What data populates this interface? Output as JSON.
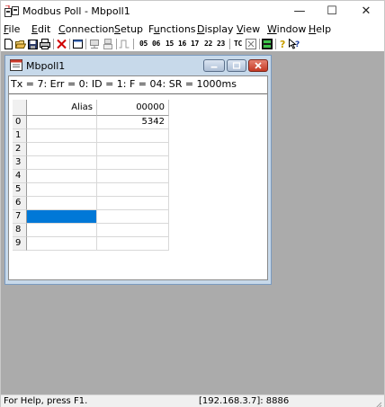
{
  "window": {
    "title": "Modbus Poll - Mbpoll1",
    "controls": {
      "minimize": "—",
      "maximize": "☐",
      "close": "✕"
    }
  },
  "menu": [
    {
      "pre": "",
      "u": "F",
      "post": "ile"
    },
    {
      "pre": "",
      "u": "E",
      "post": "dit"
    },
    {
      "pre": "",
      "u": "C",
      "post": "onnection"
    },
    {
      "pre": "",
      "u": "S",
      "post": "etup"
    },
    {
      "pre": "F",
      "u": "u",
      "post": "nctions"
    },
    {
      "pre": "",
      "u": "D",
      "post": "isplay"
    },
    {
      "pre": "",
      "u": "V",
      "post": "iew"
    },
    {
      "pre": "",
      "u": "W",
      "post": "indow"
    },
    {
      "pre": "",
      "u": "H",
      "post": "elp"
    }
  ],
  "toolbar": {
    "function_codes": [
      "05",
      "06",
      "15",
      "16",
      "17",
      "22",
      "23"
    ],
    "tc_label": "TC",
    "icons": [
      "new-icon",
      "open-icon",
      "save-icon",
      "print-icon",
      "delete-icon",
      "window-icon",
      "connect-icon",
      "disconnect-icon",
      "pulse-icon",
      "communication-icon",
      "monitor-icon",
      "about-icon",
      "context-help-icon"
    ]
  },
  "child": {
    "title": "Mbpoll1",
    "status_line": "Tx = 7: Err = 0: ID = 1: F = 04: SR = 1000ms",
    "grid": {
      "col_alias": "Alias",
      "col_value": "00000",
      "rows": [
        {
          "n": "0",
          "value": "5342"
        },
        {
          "n": "1",
          "value": ""
        },
        {
          "n": "2",
          "value": ""
        },
        {
          "n": "3",
          "value": ""
        },
        {
          "n": "4",
          "value": ""
        },
        {
          "n": "5",
          "value": ""
        },
        {
          "n": "6",
          "value": ""
        },
        {
          "n": "7",
          "value": ""
        },
        {
          "n": "8",
          "value": ""
        },
        {
          "n": "9",
          "value": ""
        }
      ],
      "selected_row": 7
    }
  },
  "statusbar": {
    "help": "For Help, press F1.",
    "connection": "[192.168.3.7]: 8886"
  },
  "colors": {
    "mdi_background": "#ababab",
    "child_frame": "#c7d9ea",
    "selection": "#0078d7",
    "close_button": "#c53a25"
  }
}
